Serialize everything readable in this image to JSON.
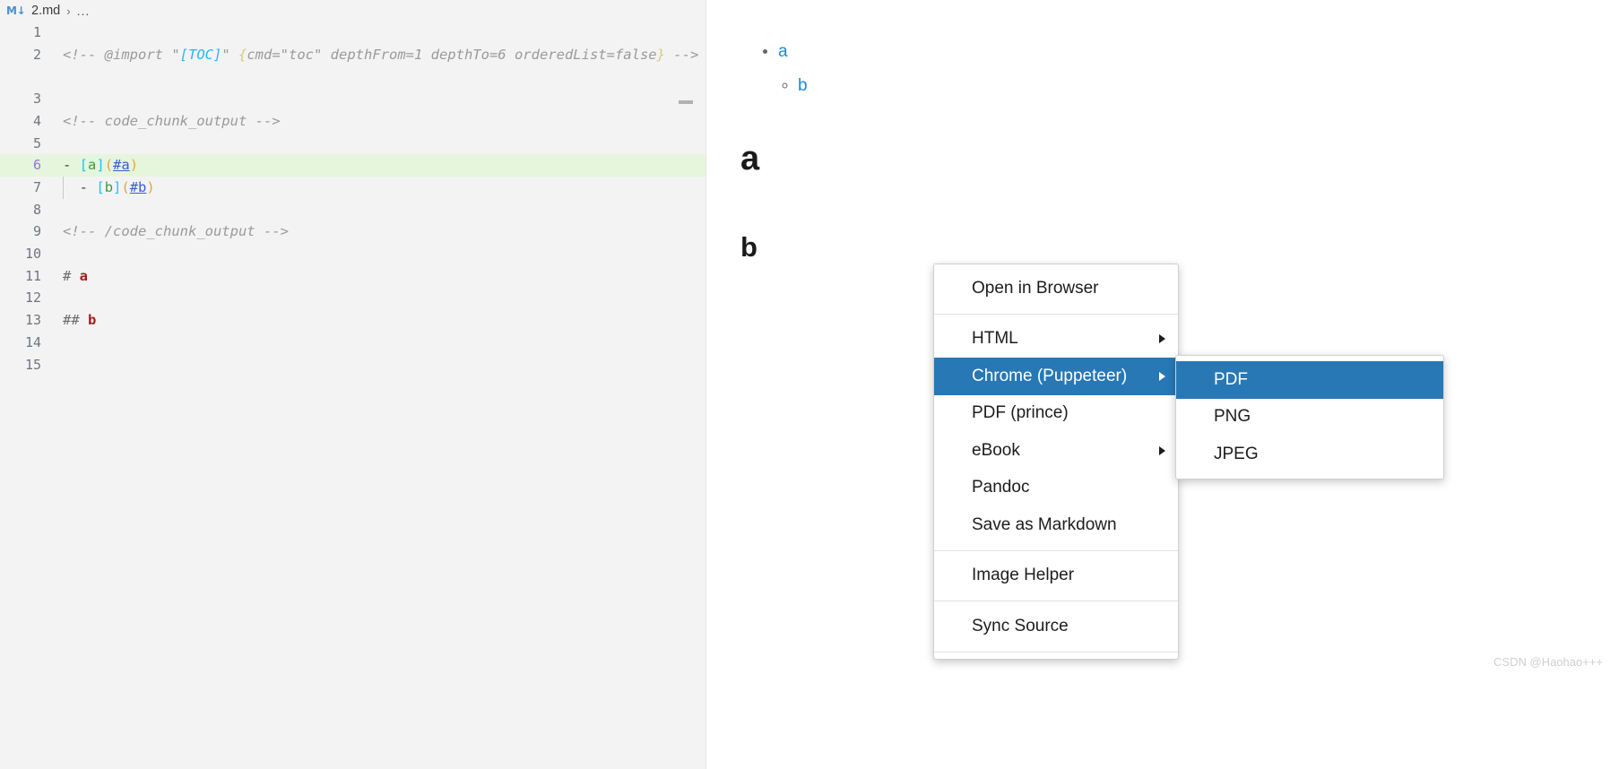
{
  "editor": {
    "breadcrumb": {
      "file_icon": "M↓",
      "filename": "2.md",
      "separator": "›",
      "symbol": "..."
    },
    "lines": [
      {
        "no": "1",
        "segments": []
      },
      {
        "no": "2",
        "wrap": true,
        "segments": [
          {
            "cls": "cmt",
            "t": "<!-- @import \""
          },
          {
            "cls": "cmt-toc",
            "t": "[TOC]"
          },
          {
            "cls": "cmt",
            "t": "\" "
          },
          {
            "cls": "cmt-brace",
            "t": "{"
          },
          {
            "cls": "cmt",
            "t": "cmd=\"toc\" depthFrom=1 depthTo=6 orderedList=false"
          },
          {
            "cls": "cmt-brace",
            "t": "}"
          },
          {
            "cls": "cmt",
            "t": " -->"
          }
        ]
      },
      {
        "no": "3",
        "segments": []
      },
      {
        "no": "4",
        "segments": [
          {
            "cls": "cmt",
            "t": "<!-- code_chunk_output -->"
          }
        ]
      },
      {
        "no": "5",
        "segments": []
      },
      {
        "no": "6",
        "highlight": true,
        "active": true,
        "segments": [
          {
            "cls": "md-dash",
            "t": "- "
          },
          {
            "cls": "md-bracket",
            "t": "["
          },
          {
            "cls": "md-text",
            "t": "a"
          },
          {
            "cls": "md-bracket",
            "t": "]"
          },
          {
            "cls": "md-paren",
            "t": "("
          },
          {
            "cls": "md-url",
            "t": "#a"
          },
          {
            "cls": "md-paren",
            "t": ")"
          }
        ]
      },
      {
        "no": "7",
        "guide": true,
        "segments": [
          {
            "cls": "md-dash",
            "t": "  - "
          },
          {
            "cls": "md-bracket",
            "t": "["
          },
          {
            "cls": "md-text",
            "t": "b"
          },
          {
            "cls": "md-bracket",
            "t": "]"
          },
          {
            "cls": "md-paren",
            "t": "("
          },
          {
            "cls": "md-url",
            "t": "#b"
          },
          {
            "cls": "md-paren",
            "t": ")"
          }
        ]
      },
      {
        "no": "8",
        "segments": []
      },
      {
        "no": "9",
        "segments": [
          {
            "cls": "cmt",
            "t": "<!-- /code_chunk_output -->"
          }
        ]
      },
      {
        "no": "10",
        "segments": []
      },
      {
        "no": "11",
        "segments": [
          {
            "cls": "md-hash",
            "t": "# "
          },
          {
            "cls": "md-head",
            "t": "a"
          }
        ]
      },
      {
        "no": "12",
        "segments": []
      },
      {
        "no": "13",
        "segments": [
          {
            "cls": "md-hash",
            "t": "## "
          },
          {
            "cls": "md-head",
            "t": "b"
          }
        ]
      },
      {
        "no": "14",
        "segments": []
      },
      {
        "no": "15",
        "segments": []
      }
    ]
  },
  "preview": {
    "toc": [
      {
        "label": "a",
        "children": [
          {
            "label": "b"
          }
        ]
      }
    ],
    "heading1": "a",
    "heading2": "b",
    "watermark": "CSDN @Haohao+++"
  },
  "context_menu": {
    "items": [
      {
        "label": "Open in Browser",
        "submenu": false,
        "selected": false
      },
      {
        "separator": true
      },
      {
        "label": "HTML",
        "submenu": true,
        "selected": false
      },
      {
        "label": "Chrome (Puppeteer)",
        "submenu": true,
        "selected": true
      },
      {
        "label": "PDF (prince)",
        "submenu": false,
        "selected": false
      },
      {
        "label": "eBook",
        "submenu": true,
        "selected": false
      },
      {
        "label": "Pandoc",
        "submenu": false,
        "selected": false
      },
      {
        "label": "Save as Markdown",
        "submenu": false,
        "selected": false
      },
      {
        "separator": true
      },
      {
        "label": "Image Helper",
        "submenu": false,
        "selected": false
      },
      {
        "separator": true
      },
      {
        "label": "Sync Source",
        "submenu": false,
        "selected": false
      },
      {
        "separator": true
      }
    ],
    "submenu": {
      "items": [
        {
          "label": "PDF",
          "selected": true
        },
        {
          "label": "PNG",
          "selected": false
        },
        {
          "label": "JPEG",
          "selected": false
        }
      ]
    }
  },
  "colors": {
    "menu_selected_bg": "#2878b5",
    "editor_bg": "#f3f3f3",
    "current_line_bg": "#e5f6dc",
    "link_blue": "#1e8ad6",
    "heading_red": "#a61d1d"
  }
}
